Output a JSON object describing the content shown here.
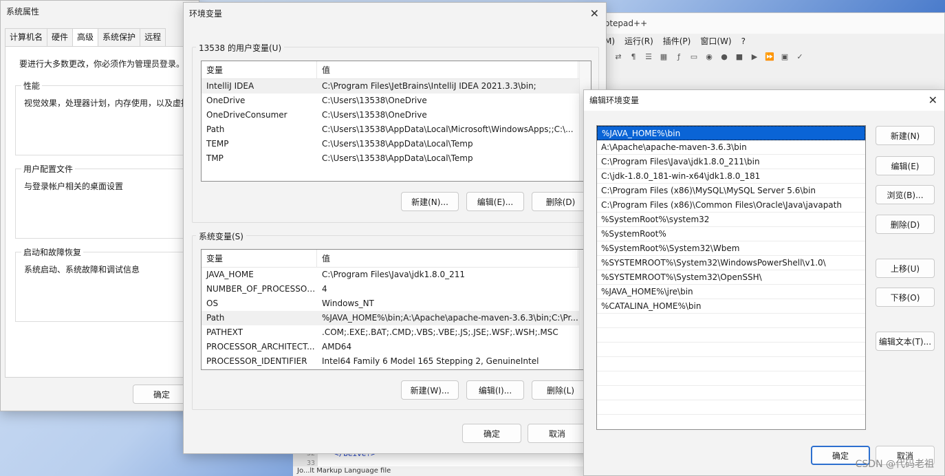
{
  "npp": {
    "title": "otepad++",
    "menu": [
      "M)",
      "运行(R)",
      "插件(P)",
      "窗口(W)",
      "?"
    ],
    "editor_lines": [
      "32",
      "33"
    ],
    "code": "</beive?>",
    "status": "Jo...lt Markup Language file"
  },
  "sysprop": {
    "title": "系统属性",
    "tabs": [
      "计算机名",
      "硬件",
      "高级",
      "系统保护",
      "远程"
    ],
    "note": "要进行大多数更改，你必须作为管理员登录。",
    "sections": [
      {
        "title": "性能",
        "desc": "视觉效果，处理器计划，内存使用，以及虚拟"
      },
      {
        "title": "用户配置文件",
        "desc": "与登录帐户相关的桌面设置"
      },
      {
        "title": "启动和故障恢复",
        "desc": "系统启动、系统故障和调试信息"
      }
    ],
    "ok": "确定"
  },
  "envvars": {
    "title": "环境变量",
    "user_group": "13538 的用户变量(U)",
    "col_var": "变量",
    "col_val": "值",
    "user_vars": [
      {
        "name": "IntelliJ IDEA",
        "value": "C:\\Program Files\\JetBrains\\IntelliJ IDEA 2021.3.3\\bin;"
      },
      {
        "name": "OneDrive",
        "value": "C:\\Users\\13538\\OneDrive"
      },
      {
        "name": "OneDriveConsumer",
        "value": "C:\\Users\\13538\\OneDrive"
      },
      {
        "name": "Path",
        "value": "C:\\Users\\13538\\AppData\\Local\\Microsoft\\WindowsApps;;C:\\..."
      },
      {
        "name": "TEMP",
        "value": "C:\\Users\\13538\\AppData\\Local\\Temp"
      },
      {
        "name": "TMP",
        "value": "C:\\Users\\13538\\AppData\\Local\\Temp"
      }
    ],
    "user_buttons": {
      "new": "新建(N)...",
      "edit": "编辑(E)...",
      "delete": "删除(D)"
    },
    "sys_group": "系统变量(S)",
    "sys_vars": [
      {
        "name": "JAVA_HOME",
        "value": "C:\\Program Files\\Java\\jdk1.8.0_211"
      },
      {
        "name": "NUMBER_OF_PROCESSORS",
        "value": "4"
      },
      {
        "name": "OS",
        "value": "Windows_NT"
      },
      {
        "name": "Path",
        "value": "%JAVA_HOME%\\bin;A:\\Apache\\apache-maven-3.6.3\\bin;C:\\Pr..."
      },
      {
        "name": "PATHEXT",
        "value": ".COM;.EXE;.BAT;.CMD;.VBS;.VBE;.JS;.JSE;.WSF;.WSH;.MSC"
      },
      {
        "name": "PROCESSOR_ARCHITECT...",
        "value": "AMD64"
      },
      {
        "name": "PROCESSOR_IDENTIFIER",
        "value": "Intel64 Family 6 Model 165 Stepping 2, GenuineIntel"
      }
    ],
    "sys_buttons": {
      "new": "新建(W)...",
      "edit": "编辑(I)...",
      "delete": "删除(L)"
    },
    "ok": "确定",
    "cancel": "取消"
  },
  "editenv": {
    "title": "编辑环境变量",
    "items": [
      "%JAVA_HOME%\\bin",
      "A:\\Apache\\apache-maven-3.6.3\\bin",
      "C:\\Program Files\\Java\\jdk1.8.0_211\\bin",
      "C:\\jdk-1.8.0_181-win-x64\\jdk1.8.0_181",
      "C:\\Program Files (x86)\\MySQL\\MySQL Server 5.6\\bin",
      "C:\\Program Files (x86)\\Common Files\\Oracle\\Java\\javapath",
      "%SystemRoot%\\system32",
      "%SystemRoot%",
      "%SystemRoot%\\System32\\Wbem",
      "%SYSTEMROOT%\\System32\\WindowsPowerShell\\v1.0\\",
      "%SYSTEMROOT%\\System32\\OpenSSH\\",
      "%JAVA_HOME%\\jre\\bin",
      "%CATALINA_HOME%\\bin"
    ],
    "buttons": {
      "new": "新建(N)",
      "edit": "编辑(E)",
      "browse": "浏览(B)...",
      "delete": "删除(D)",
      "up": "上移(U)",
      "down": "下移(O)",
      "edit_text": "编辑文本(T)..."
    },
    "ok": "确定",
    "cancel": "取消"
  },
  "watermark": "CSDN @代码老祖"
}
